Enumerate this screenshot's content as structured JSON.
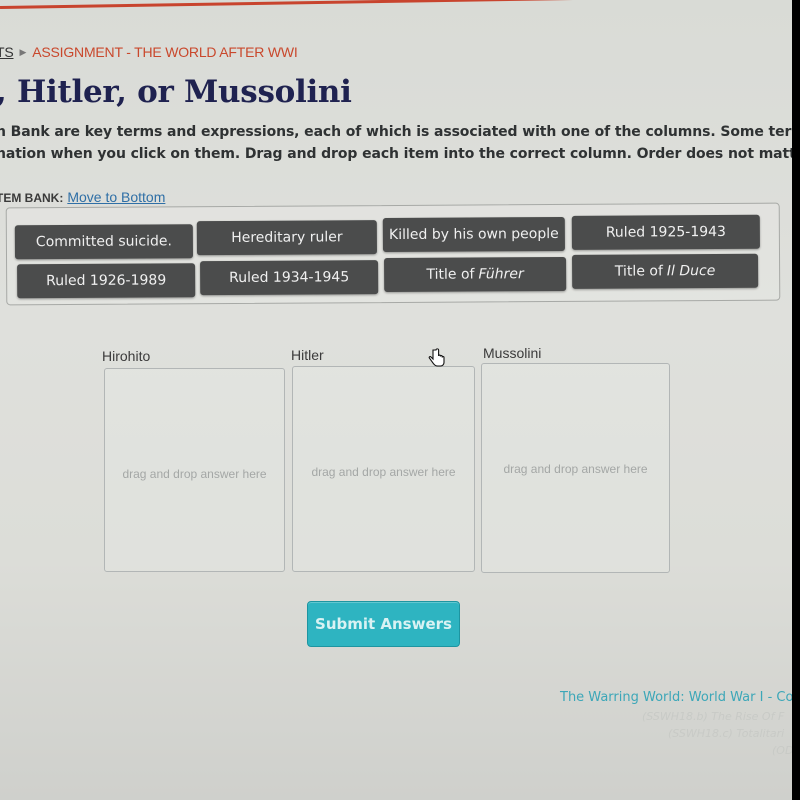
{
  "breadcrumb": {
    "previous": "TS",
    "separator_icon": "caret-right-icon",
    "current": "ASSIGNMENT - THE WORLD AFTER WWI"
  },
  "page_title": ", Hitler, or Mussolini",
  "instructions": {
    "line1": "n Bank are key terms and expressions, each of which is associated with one of the columns. Some term",
    "line2": "nation when you click on them. Drag and drop each item into the correct column. Order does not matte"
  },
  "item_bank": {
    "label": "TEM BANK:",
    "move_link": "Move to Bottom",
    "items": [
      {
        "text": "Committed suicide.",
        "italic": ""
      },
      {
        "text": "Hereditary ruler",
        "italic": ""
      },
      {
        "text": "Killed by his own people",
        "italic": ""
      },
      {
        "text": "Ruled 1925-1943",
        "italic": ""
      },
      {
        "text": "Ruled 1926-1989",
        "italic": ""
      },
      {
        "text": "Ruled 1934-1945",
        "italic": ""
      },
      {
        "text": "Title of",
        "italic": "Führer"
      },
      {
        "text": "Title of",
        "italic": "Il Duce"
      }
    ]
  },
  "columns": [
    {
      "label": "Hirohito",
      "placeholder": "drag and drop answer here"
    },
    {
      "label": "Hitler",
      "placeholder": "drag and drop answer here"
    },
    {
      "label": "Mussolini",
      "placeholder": "drag and drop answer here"
    }
  ],
  "submit_label": "Submit Answers",
  "footer": {
    "link": "The Warring World: World War I - Co",
    "faint_lines": [
      "(SSWH18.b) The Rise Of F",
      "(SSWH18.c) Totalitari",
      "(OD"
    ]
  },
  "colors": {
    "breadcrumb": "#c9482c",
    "title": "#1f2250",
    "chip": "#4b4c4c",
    "submit": "#2eb4c1",
    "footer_link": "#3ca7b8"
  }
}
